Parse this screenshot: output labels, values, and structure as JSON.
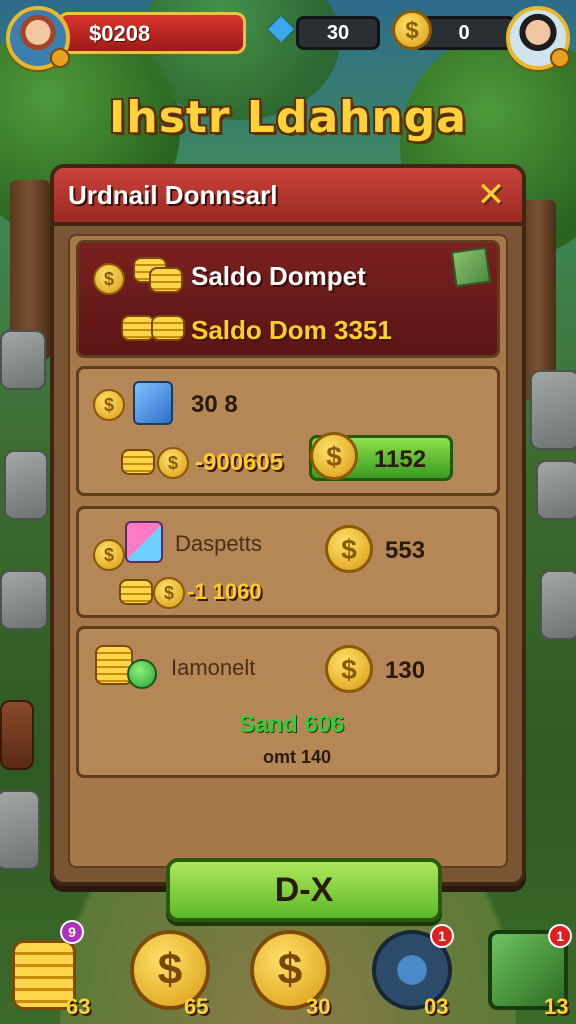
{
  "hud": {
    "money": "$0208",
    "gems": "30",
    "gold": "0"
  },
  "title": "Ihstr Ldahnga",
  "panel": {
    "title": "Urdnail Donnsarl",
    "close_label": "✕",
    "row1": {
      "label": "Saldo Dompet",
      "value": "Saldo Dom 3351"
    },
    "row2": {
      "value_top": "30 8",
      "value_bottom": "-900605",
      "button_value": "1152"
    },
    "row3": {
      "label": "Daspetts",
      "value_bottom": "-1 1060",
      "value_right": "553"
    },
    "row4": {
      "label": "Iamonelt",
      "value_right": "130",
      "green_text": "Sand 606",
      "small_text": "omt 140"
    },
    "main_button": "D-X"
  },
  "bottom_bar": {
    "items": [
      {
        "name": "coin-stack",
        "count": "63",
        "badge": "9"
      },
      {
        "name": "coin-shop",
        "count": "65"
      },
      {
        "name": "coin-bank",
        "count": "30"
      },
      {
        "name": "settings",
        "count": "03",
        "badge": "1"
      },
      {
        "name": "chest",
        "count": "13",
        "badge": "1"
      }
    ]
  },
  "colors": {
    "panel_header": "#c9423a",
    "accent_gold": "#ffd23a",
    "button_green": "#7ccc3a"
  }
}
